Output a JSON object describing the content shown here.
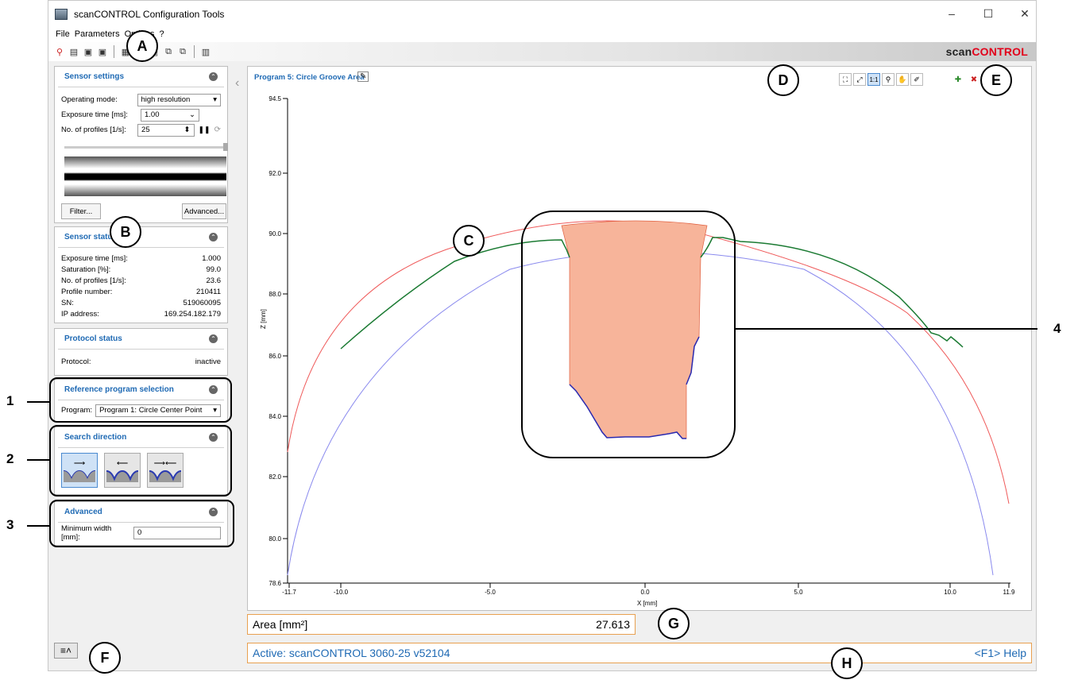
{
  "window": {
    "title": "scanCONTROL Configuration Tools",
    "controls": [
      "–",
      "☐",
      "✕"
    ]
  },
  "menu": [
    "File",
    "Parameters",
    "Options",
    "?"
  ],
  "brand": {
    "left": "scan",
    "right": "CONTROL"
  },
  "sensor_settings": {
    "title": "Sensor settings",
    "operating_mode_label": "Operating mode:",
    "operating_mode_value": "high resolution",
    "exposure_label": "Exposure time [ms]:",
    "exposure_value": "1.00",
    "profiles_label": "No. of profiles [1/s]:",
    "profiles_value": "25",
    "filter_button": "Filter...",
    "advanced_button": "Advanced..."
  },
  "sensor_status": {
    "title": "Sensor status",
    "rows": [
      {
        "label": "Exposure time [ms]:",
        "value": "1.000"
      },
      {
        "label": "Saturation [%]:",
        "value": "99.0"
      },
      {
        "label": "No. of profiles [1/s]:",
        "value": "23.6"
      },
      {
        "label": "Profile number:",
        "value": "210411"
      },
      {
        "label": "SN:",
        "value": "519060095"
      },
      {
        "label": "IP address:",
        "value": "169.254.182.179"
      }
    ]
  },
  "protocol_status": {
    "title": "Protocol status",
    "label": "Protocol:",
    "value": "inactive"
  },
  "reference_program": {
    "title": "Reference program selection",
    "label": "Program:",
    "value": "Program 1: Circle Center Point"
  },
  "search_direction": {
    "title": "Search direction",
    "selected": 0
  },
  "advanced": {
    "title": "Advanced",
    "min_width_label": "Minimum width [mm]:",
    "min_width_value": "0"
  },
  "graph": {
    "title": "Program 5: Circle Groove Area",
    "xlabel": "X [mm]",
    "ylabel": "Z [mm]",
    "x_ticks": [
      "-11.7",
      "-10.0",
      "-5.0",
      "0.0",
      "5.0",
      "10.0",
      "11.9"
    ],
    "y_ticks": [
      "94.5",
      "92.0",
      "90.0",
      "88.0",
      "86.0",
      "84.0",
      "82.0",
      "80.0",
      "78.6"
    ]
  },
  "result": {
    "label": "Area [mm²]",
    "value": "27.613"
  },
  "status": {
    "text": "Active: scanCONTROL 3060-25 v52104",
    "help": "<F1> Help"
  },
  "callouts": [
    "A",
    "B",
    "C",
    "D",
    "E",
    "F",
    "G",
    "H"
  ],
  "side_numbers": [
    "1",
    "2",
    "3",
    "4"
  ]
}
